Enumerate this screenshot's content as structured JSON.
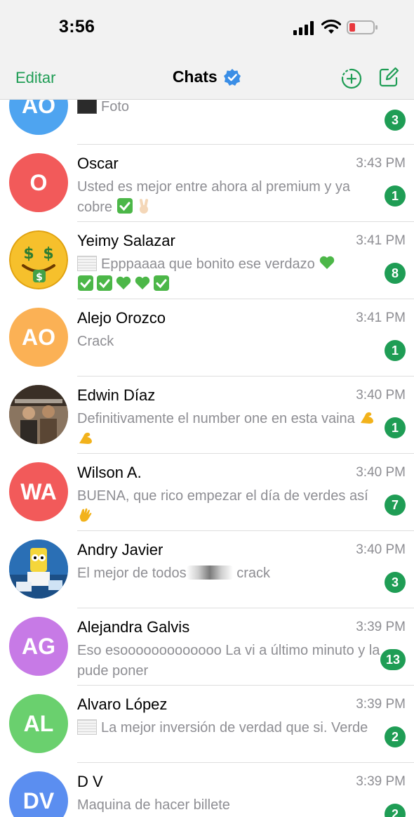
{
  "status_bar": {
    "time": "3:56"
  },
  "nav": {
    "edit_label": "Editar",
    "title": "Chats"
  },
  "colors": {
    "accent": "#1f9d55",
    "secondary_text": "#8e8e93"
  },
  "chats": [
    {
      "name": "",
      "initials": "AO",
      "avatar_color": "#4ea4f0",
      "time": "",
      "preview": "Foto",
      "badge": "3"
    },
    {
      "name": "Oscar",
      "initials": "O",
      "avatar_color": "#f25a5a",
      "time": "3:43 PM",
      "preview": "Usted es mejor entre ahora al premium y ya cobre",
      "badge": "1"
    },
    {
      "name": "Yeimy Salazar",
      "initials": "",
      "avatar_color": "#f6c02c",
      "time": "3:41 PM",
      "preview": "Epppaaaa que bonito ese verdazo",
      "badge": "8"
    },
    {
      "name": "Alejo Orozco",
      "initials": "AO",
      "avatar_color": "#fbb155",
      "time": "3:41 PM",
      "preview": "Crack",
      "badge": "1"
    },
    {
      "name": "Edwin Díaz",
      "initials": "",
      "avatar_color": "#6a5a4a",
      "time": "3:40 PM",
      "preview": "Definitivamente el number one en esta vaina",
      "badge": "1"
    },
    {
      "name": "Wilson A.",
      "initials": "WA",
      "avatar_color": "#f25a5a",
      "time": "3:40 PM",
      "preview": "BUENA, que rico empezar el día de verdes así",
      "badge": "7"
    },
    {
      "name": "Andry Javier",
      "initials": "",
      "avatar_color": "#2a6fb5",
      "time": "3:40 PM",
      "preview_before": "El mejor de todos",
      "preview_after": " crack",
      "badge": "3"
    },
    {
      "name": "Alejandra Galvis",
      "initials": "AG",
      "avatar_color": "#c77ae6",
      "time": "3:39 PM",
      "preview": "Eso esooooooooooooo La vi a último minuto y la pude poner",
      "badge": "13"
    },
    {
      "name": "Alvaro López",
      "initials": "AL",
      "avatar_color": "#6ad06e",
      "time": "3:39 PM",
      "preview": "La mejor inversión de verdad que si. Verde",
      "badge": "2"
    },
    {
      "name": "D V",
      "initials": "DV",
      "avatar_color": "#5b8ef0",
      "time": "3:39 PM",
      "preview": "Maquina de hacer billete",
      "badge": "2"
    }
  ]
}
